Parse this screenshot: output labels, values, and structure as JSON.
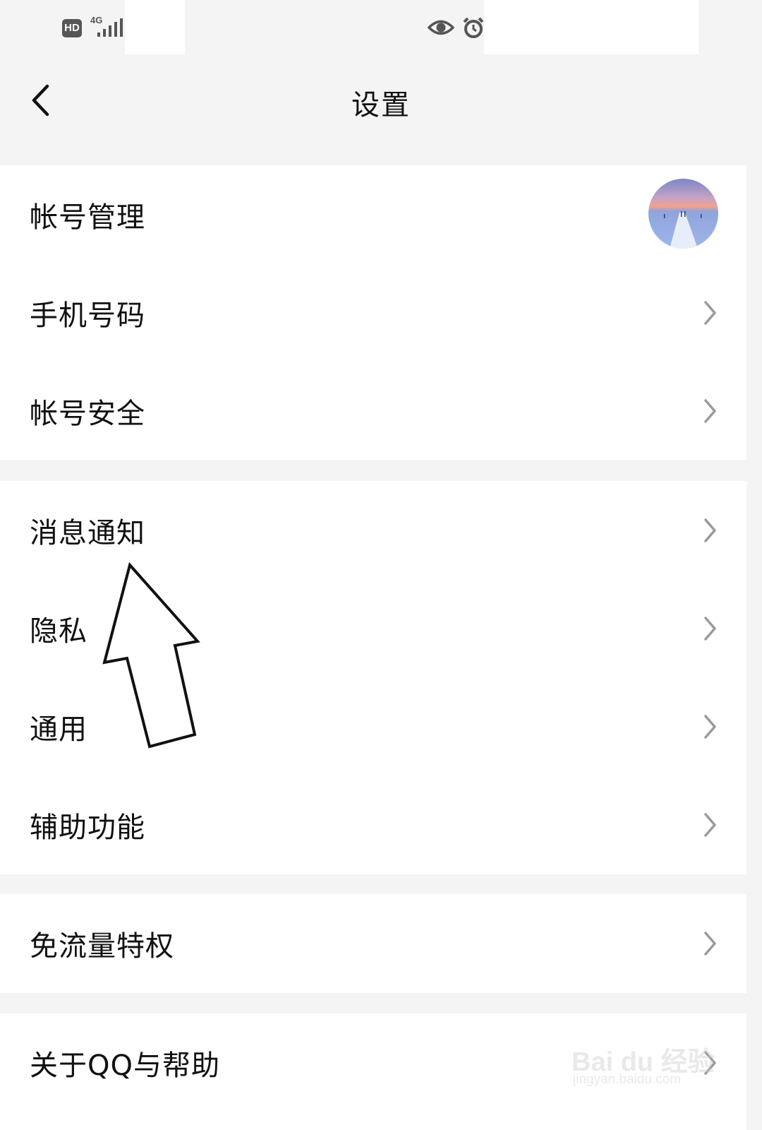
{
  "status_bar": {
    "hd_badge": "HD",
    "network_type": "4G"
  },
  "header": {
    "title": "设置"
  },
  "groups": [
    {
      "items": [
        {
          "label": "帐号管理",
          "trailing": "avatar"
        },
        {
          "label": "手机号码",
          "trailing": "chevron-right-icon"
        },
        {
          "label": "帐号安全",
          "trailing": "chevron-right-icon"
        }
      ]
    },
    {
      "items": [
        {
          "label": "消息通知",
          "trailing": "chevron-right-icon"
        },
        {
          "label": "隐私",
          "trailing": "chevron-right-icon"
        },
        {
          "label": "通用",
          "trailing": "chevron-right-icon"
        },
        {
          "label": "辅助功能",
          "trailing": "chevron-right-icon"
        }
      ]
    },
    {
      "items": [
        {
          "label": "免流量特权",
          "trailing": "chevron-right-icon"
        }
      ]
    },
    {
      "items": [
        {
          "label": "关于QQ与帮助",
          "trailing": "chevron-right-icon"
        }
      ]
    }
  ],
  "annotation": {
    "arrow_target": "消息通知"
  },
  "watermark": {
    "logo": "Bai du 经验",
    "url": "jingyan.baidu.com"
  },
  "colors": {
    "background": "#f4f4f4",
    "card": "#ffffff",
    "text": "#111111",
    "chevron": "#9a9a9a"
  }
}
